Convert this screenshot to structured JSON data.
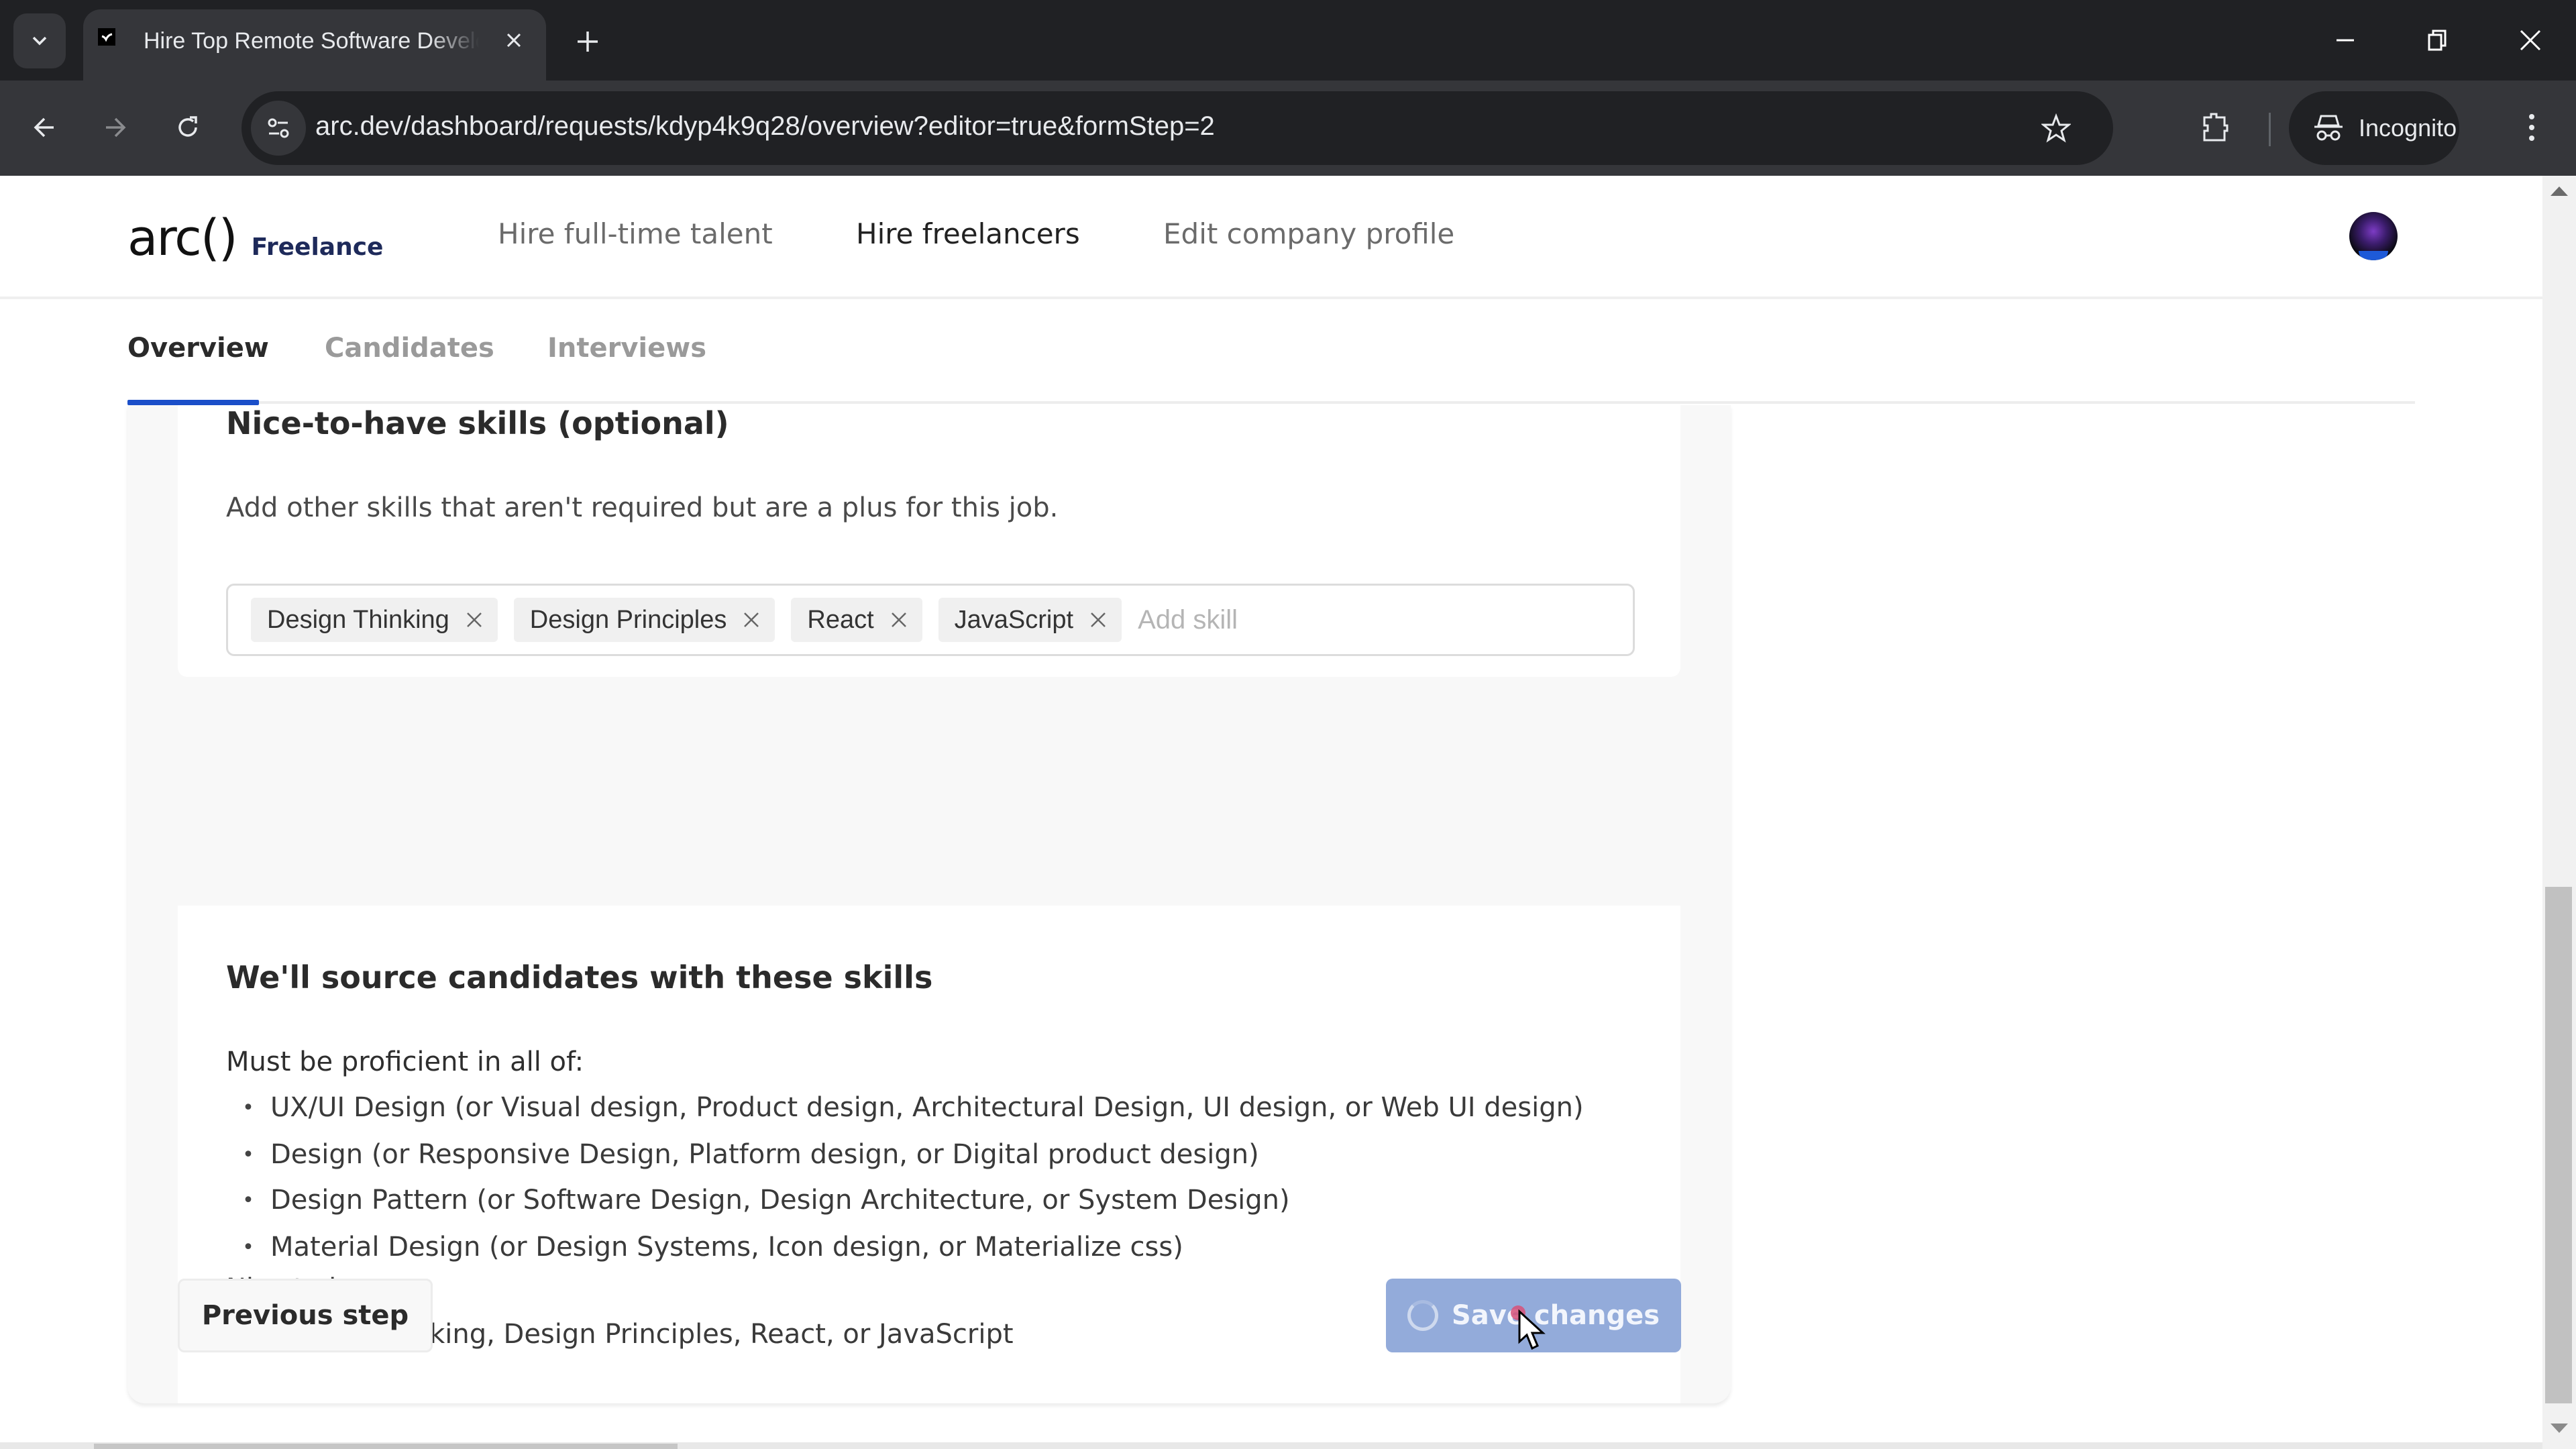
{
  "browser": {
    "tab_title": "Hire Top Remote Software Developers",
    "url": "arc.dev/dashboard/requests/kdyp4k9q28/overview?editor=true&formStep=2",
    "incognito_label": "Incognito",
    "icons": {
      "tab_search": "chevron-down-icon",
      "favicon": "arc-favicon",
      "tab_close": "close-icon",
      "new_tab": "plus-icon",
      "minimize": "minimize-icon",
      "restore": "restore-icon",
      "window_close": "close-icon",
      "back": "arrow-left-icon",
      "forward": "arrow-right-icon",
      "reload": "reload-icon",
      "site_info": "tune-icon",
      "bookmark": "star-icon",
      "extensions": "puzzle-icon",
      "incognito": "incognito-icon",
      "menu": "more-vert-icon"
    }
  },
  "header": {
    "logo": "arc()",
    "logo_sub": "Freelance",
    "nav": [
      {
        "label": "Hire full-time talent",
        "active": false
      },
      {
        "label": "Hire freelancers",
        "active": true
      },
      {
        "label": "Edit company profile",
        "active": false
      }
    ]
  },
  "subtabs": [
    {
      "label": "Overview",
      "active": true
    },
    {
      "label": "Candidates",
      "active": false
    },
    {
      "label": "Interviews",
      "active": false
    }
  ],
  "nice_to_have": {
    "title": "Nice-to-have skills (optional)",
    "description": "Add other skills that aren't required but are a plus for this job.",
    "chips": [
      {
        "label": "Design Thinking"
      },
      {
        "label": "Design Principles"
      },
      {
        "label": "React"
      },
      {
        "label": "JavaScript"
      }
    ],
    "input_value": "",
    "input_placeholder": "Add skill"
  },
  "summary": {
    "title": "We'll source candidates with these skills",
    "must_label": "Must be proficient in all of:",
    "must_items": [
      "UX/UI Design (or Visual design, Product design, Architectural Design, UI design, or Web UI design)",
      "Design (or Responsive Design, Platform design, or Digital product design)",
      "Design Pattern (or Software Design, Design Architecture, or System Design)",
      "Material Design (or Design Systems, Icon design, or Materialize css)"
    ],
    "nice_label": "Nice to have:",
    "nice_items": [
      "Design Thinking, Design Principles, React, or JavaScript"
    ]
  },
  "actions": {
    "previous_label": "Previous step",
    "save_label": "Save changes",
    "save_state": "loading"
  },
  "colors": {
    "accent": "#1b4fc9",
    "save_button_loading": "#93abda",
    "chip_bg": "#f0f0f0"
  }
}
